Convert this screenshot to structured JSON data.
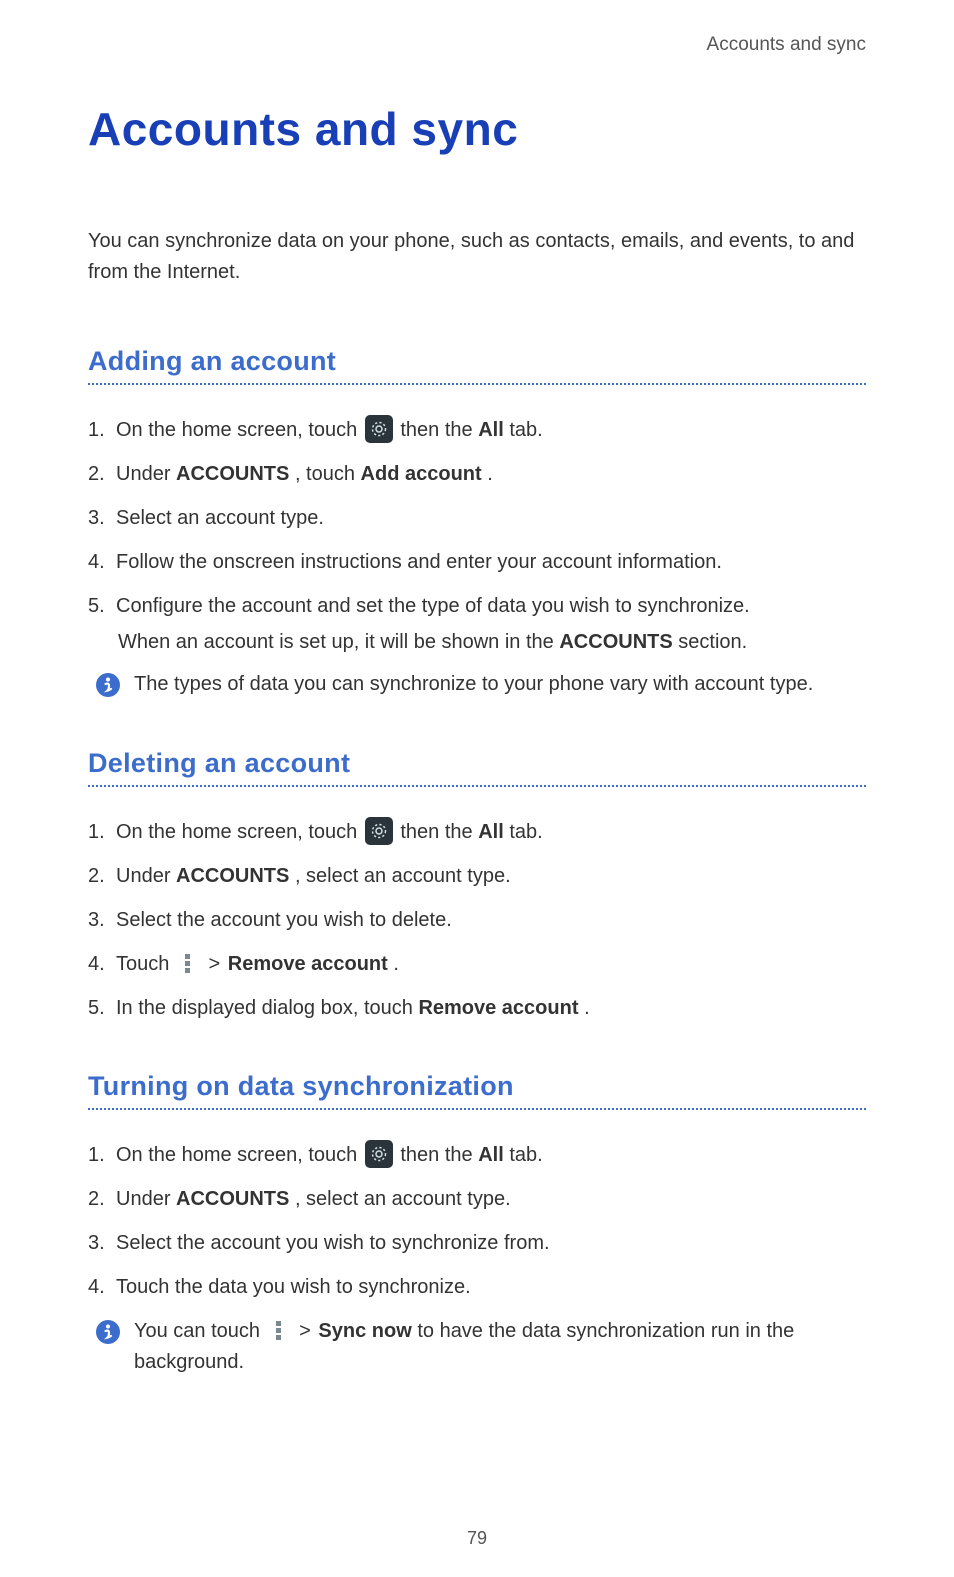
{
  "running_head": "Accounts and sync",
  "title": "Accounts and sync",
  "intro": "You can synchronize data on your phone, such as contacts, emails, and events, to and from the Internet.",
  "section1": {
    "heading": "Adding an account",
    "step1_pre": "On the home screen, touch ",
    "step1_post": " then the ",
    "step1_bold": "All",
    "step1_tail": " tab.",
    "step2_pre": "Under ",
    "step2_bold1": "ACCOUNTS",
    "step2_mid": ", touch ",
    "step2_bold2": "Add account",
    "step2_tail": ".",
    "step3": "Select an account type.",
    "step4": "Follow the onscreen instructions and enter your account information.",
    "step5": "Configure the account and set the type of data you wish to synchronize.",
    "step5_sub_pre": "When an account is set up, it will be shown in the ",
    "step5_sub_bold": "ACCOUNTS",
    "step5_sub_tail": " section.",
    "note": "The types of data you can synchronize to your phone vary with account type."
  },
  "section2": {
    "heading": "Deleting an account",
    "step1_pre": "On the home screen, touch ",
    "step1_post": " then the ",
    "step1_bold": "All",
    "step1_tail": " tab.",
    "step2_pre": "Under ",
    "step2_bold1": "ACCOUNTS",
    "step2_tail": ", select an account type.",
    "step3": "Select the account you wish to delete.",
    "step4_pre": "Touch ",
    "step4_caret": ">",
    "step4_bold": "Remove account",
    "step4_tail": ".",
    "step5_pre": "In the displayed dialog box, touch ",
    "step5_bold": "Remove account",
    "step5_tail": "."
  },
  "section3": {
    "heading": "Turning on data synchronization",
    "step1_pre": "On the home screen, touch ",
    "step1_post": " then the ",
    "step1_bold": "All",
    "step1_tail": " tab.",
    "step2_pre": "Under ",
    "step2_bold1": "ACCOUNTS",
    "step2_tail": ", select an account type.",
    "step3": "Select the account you wish to synchronize from.",
    "step4": "Touch the data you wish to synchronize.",
    "note_pre": "You can touch ",
    "note_caret": ">",
    "note_bold": "Sync now",
    "note_tail": " to have the data synchronization run in the background."
  },
  "page_number": "79"
}
